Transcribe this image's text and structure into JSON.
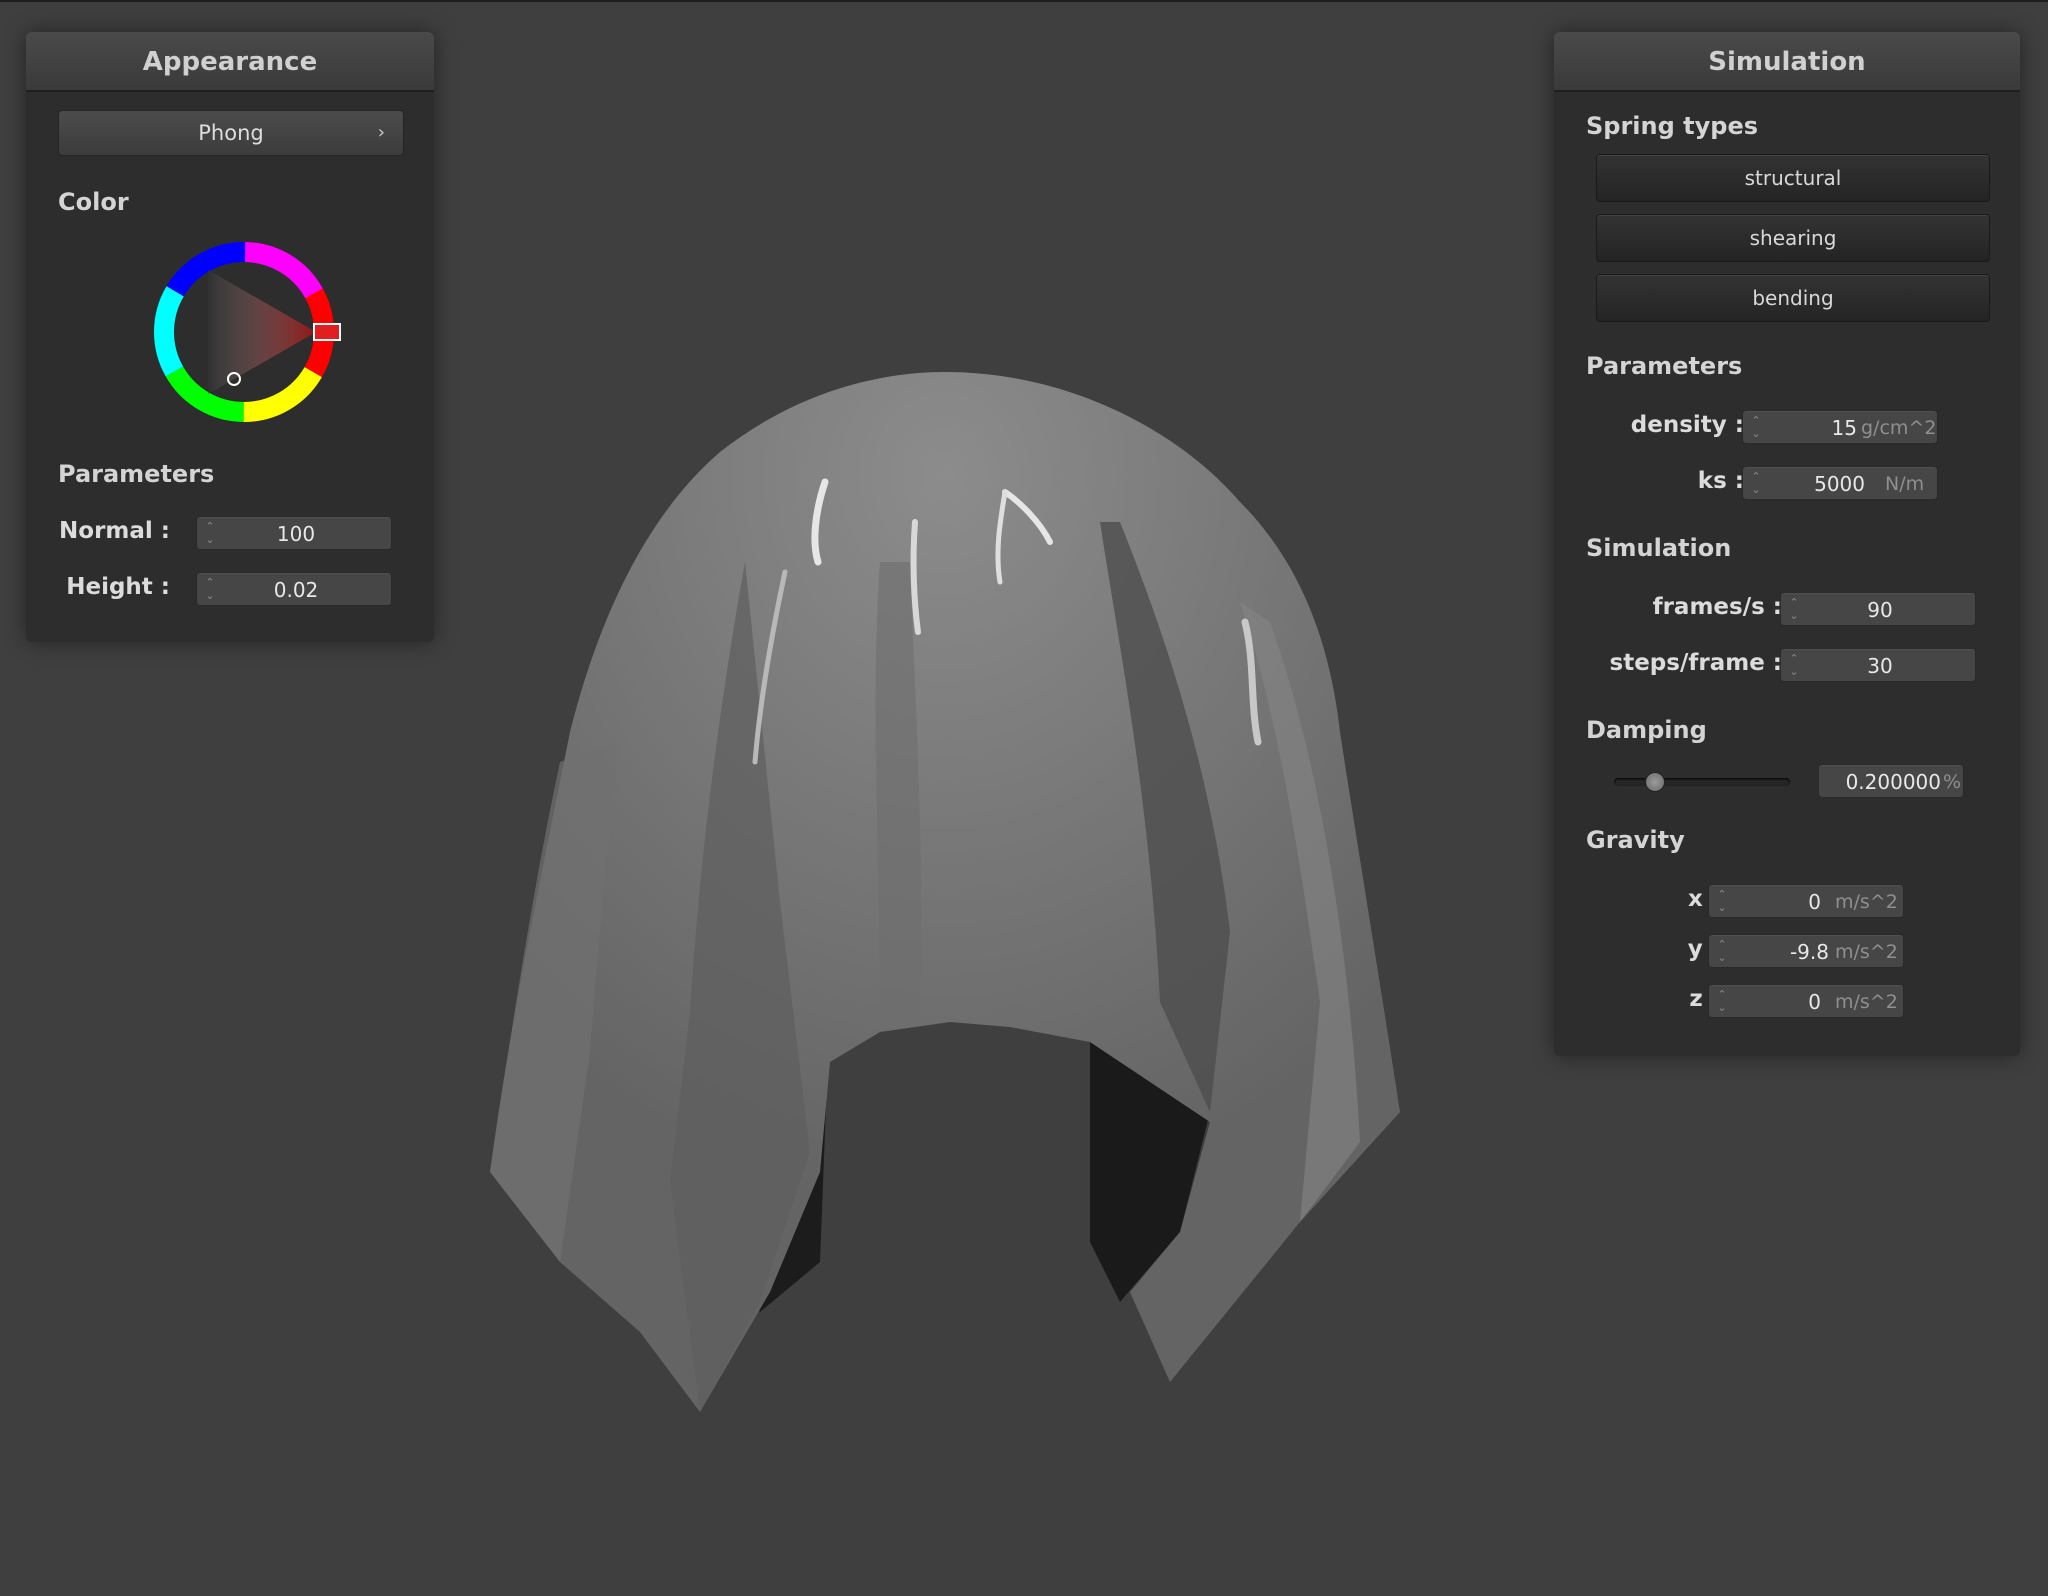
{
  "appearance": {
    "title": "Appearance",
    "shader_label": "Phong",
    "shader_chevron": "›",
    "color_label": "Color",
    "params_label": "Parameters",
    "normal_label": "Normal :",
    "normal_value": "100",
    "height_label": "Height :",
    "height_value": "0.02",
    "selected_color": "#e02020"
  },
  "simulation": {
    "title": "Simulation",
    "spring_types_label": "Spring types",
    "springs": [
      "structural",
      "shearing",
      "bending"
    ],
    "params_label": "Parameters",
    "density_label": "density :",
    "density_value": "15",
    "density_unit": "g/cm^2",
    "ks_label": "ks :",
    "ks_value": "5000",
    "ks_unit": "N/m",
    "sim_label": "Simulation",
    "fps_label": "frames/s :",
    "fps_value": "90",
    "steps_label": "steps/frame :",
    "steps_value": "30",
    "damping_label": "Damping",
    "damping_value": "0.200000",
    "damping_unit": "%",
    "damping_slider_fraction": 0.2,
    "gravity_label": "Gravity",
    "gx_label": "x :",
    "gx_value": "0",
    "gx_unit": "m/s^2",
    "gy_label": "y :",
    "gy_value": "-9.8",
    "gy_unit": "m/s^2",
    "gz_label": "z :",
    "gz_value": "0",
    "gz_unit": "m/s^2"
  },
  "icons": {
    "spin_arrows": "⌃\n⌄"
  }
}
